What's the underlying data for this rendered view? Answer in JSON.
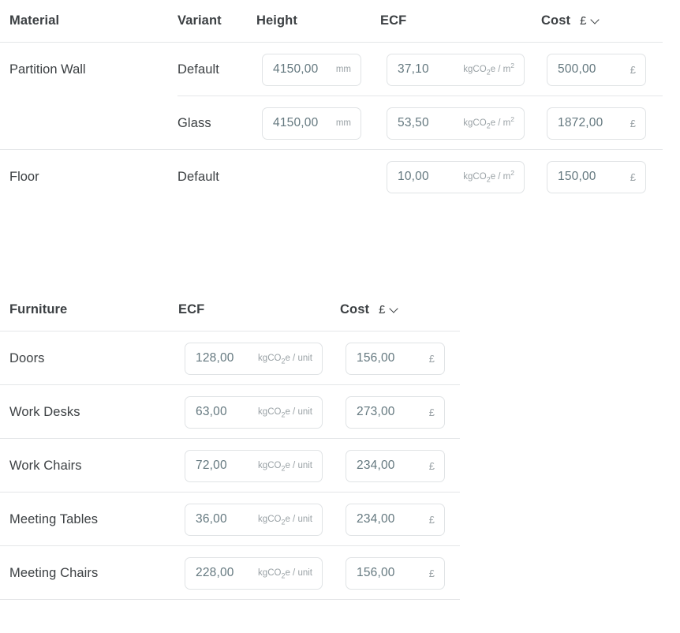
{
  "materials_table": {
    "headers": {
      "material": "Material",
      "variant": "Variant",
      "height": "Height",
      "ecf": "ECF",
      "cost": "Cost"
    },
    "currency_symbol": "£",
    "currency_chevron_icon": "chevron-down-icon",
    "units": {
      "height": "mm",
      "ecf_prefix": "kgCO",
      "ecf_sub": "2",
      "ecf_suffix": "e / m",
      "ecf_sup": "2",
      "cost": "£"
    },
    "groups": [
      {
        "name": "Partition Wall",
        "variants": [
          {
            "variant": "Default",
            "height": "4150,00",
            "ecf": "37,10",
            "cost": "500,00",
            "has_height": true
          },
          {
            "variant": "Glass",
            "height": "4150,00",
            "ecf": "53,50",
            "cost": "1872,00",
            "has_height": true
          }
        ]
      },
      {
        "name": "Floor",
        "variants": [
          {
            "variant": "Default",
            "height": "",
            "ecf": "10,00",
            "cost": "150,00",
            "has_height": false
          }
        ]
      }
    ]
  },
  "furniture_table": {
    "headers": {
      "furniture": "Furniture",
      "ecf": "ECF",
      "cost": "Cost"
    },
    "currency_symbol": "£",
    "currency_chevron_icon": "chevron-down-icon",
    "units": {
      "ecf_prefix": "kgCO",
      "ecf_sub": "2",
      "ecf_suffix": "e / unit",
      "cost": "£"
    },
    "rows": [
      {
        "name": "Doors",
        "ecf": "128,00",
        "cost": "156,00"
      },
      {
        "name": "Work Desks",
        "ecf": "63,00",
        "cost": "273,00"
      },
      {
        "name": "Work Chairs",
        "ecf": "72,00",
        "cost": "234,00"
      },
      {
        "name": "Meeting Tables",
        "ecf": "36,00",
        "cost": "234,00"
      },
      {
        "name": "Meeting Chairs",
        "ecf": "228,00",
        "cost": "156,00"
      }
    ]
  },
  "colors": {
    "header_text": "#3c4043",
    "value_text": "#64787f",
    "unit_text": "#9aa2a6",
    "border": "#e0e3e5",
    "divider": "#e4e6e8",
    "background": "#ffffff"
  }
}
